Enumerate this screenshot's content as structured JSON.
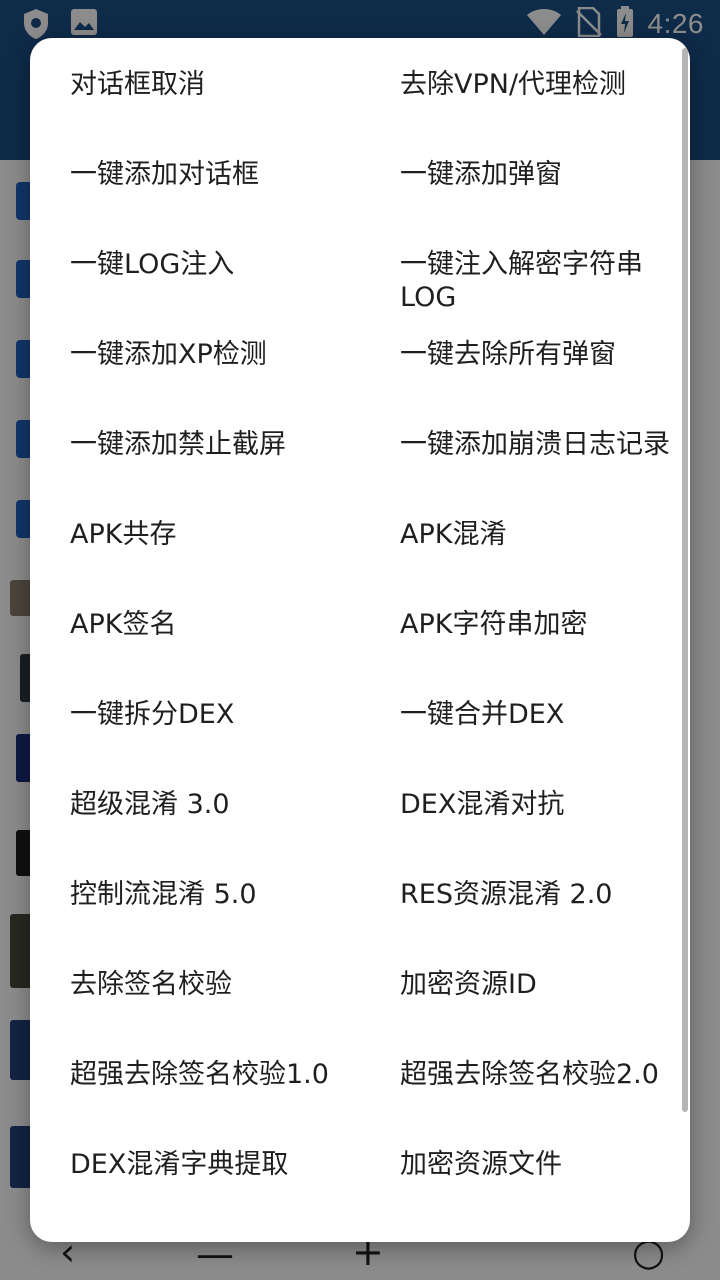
{
  "status_bar": {
    "time": "4:26",
    "icons_left": [
      "shield-icon",
      "image-icon"
    ],
    "icons_right": [
      "wifi-icon",
      "no-sim-icon",
      "battery-charging-icon"
    ]
  },
  "colors": {
    "app_primary": "#1b4f86",
    "accent_blue": "#1f63c2",
    "dialog_background": "#ffffff",
    "item_text": "#1f1f1f",
    "scrim": "rgba(0,0,0,0.45)"
  },
  "menu": {
    "items": [
      {
        "label": "对话框取消"
      },
      {
        "label": "去除VPN/代理检测"
      },
      {
        "label": "一键添加对话框"
      },
      {
        "label": "一键添加弹窗"
      },
      {
        "label": "一键LOG注入"
      },
      {
        "label": "一键注入解密字符串LOG"
      },
      {
        "label": "一键添加XP检测"
      },
      {
        "label": "一键去除所有弹窗"
      },
      {
        "label": "一键添加禁止截屏"
      },
      {
        "label": "一键添加崩溃日志记录"
      },
      {
        "label": "APK共存"
      },
      {
        "label": "APK混淆"
      },
      {
        "label": "APK签名"
      },
      {
        "label": "APK字符串加密"
      },
      {
        "label": "一键拆分DEX"
      },
      {
        "label": "一键合并DEX"
      },
      {
        "label": "超级混淆 3.0"
      },
      {
        "label": "DEX混淆对抗"
      },
      {
        "label": "控制流混淆 5.0"
      },
      {
        "label": "RES资源混淆 2.0"
      },
      {
        "label": "去除签名校验"
      },
      {
        "label": "加密资源ID"
      },
      {
        "label": "超强去除签名校验1.0"
      },
      {
        "label": "超强去除签名校验2.0"
      },
      {
        "label": "DEX混淆字典提取"
      },
      {
        "label": "加密资源文件"
      }
    ]
  }
}
